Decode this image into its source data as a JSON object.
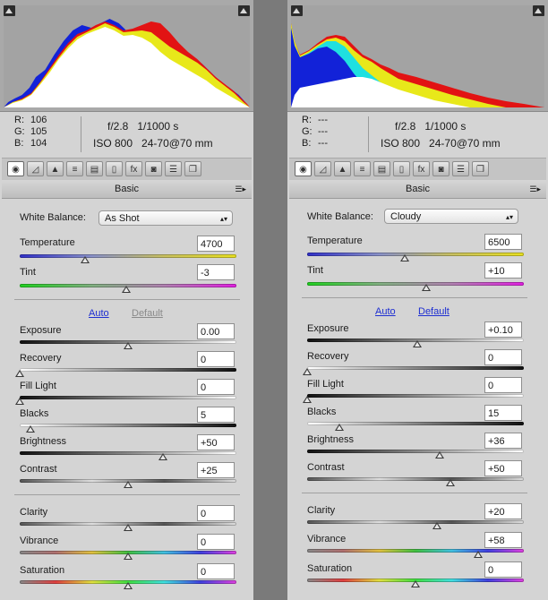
{
  "left": {
    "rgb": {
      "r_label": "R:",
      "r": "106",
      "g_label": "G:",
      "g": "105",
      "b_label": "B:",
      "b": "104"
    },
    "camera": {
      "aperture": "f/2.8",
      "shutter": "1/1000 s",
      "iso": "ISO 800",
      "lens": "24-70@70 mm"
    },
    "tab_title": "Basic",
    "white_balance": {
      "label": "White Balance:",
      "value": "As Shot"
    },
    "temperature": {
      "label": "Temperature",
      "value": "4700",
      "pos": 0.3
    },
    "tint": {
      "label": "Tint",
      "value": "-3",
      "pos": 0.49
    },
    "auto": "Auto",
    "default": "Default",
    "exposure": {
      "label": "Exposure",
      "value": "0.00",
      "pos": 0.5
    },
    "recovery": {
      "label": "Recovery",
      "value": "0",
      "pos": 0.0
    },
    "fill_light": {
      "label": "Fill Light",
      "value": "0",
      "pos": 0.0
    },
    "blacks": {
      "label": "Blacks",
      "value": "5",
      "pos": 0.05
    },
    "brightness": {
      "label": "Brightness",
      "value": "+50",
      "pos": 0.66
    },
    "contrast": {
      "label": "Contrast",
      "value": "+25",
      "pos": 0.5
    },
    "clarity": {
      "label": "Clarity",
      "value": "0",
      "pos": 0.5
    },
    "vibrance": {
      "label": "Vibrance",
      "value": "0",
      "pos": 0.5
    },
    "saturation": {
      "label": "Saturation",
      "value": "0",
      "pos": 0.5
    }
  },
  "right": {
    "rgb": {
      "r_label": "R:",
      "r": "---",
      "g_label": "G:",
      "g": "---",
      "b_label": "B:",
      "b": "---"
    },
    "camera": {
      "aperture": "f/2.8",
      "shutter": "1/1000 s",
      "iso": "ISO 800",
      "lens": "24-70@70 mm"
    },
    "tab_title": "Basic",
    "white_balance": {
      "label": "White Balance:",
      "value": "Cloudy"
    },
    "temperature": {
      "label": "Temperature",
      "value": "6500",
      "pos": 0.45
    },
    "tint": {
      "label": "Tint",
      "value": "+10",
      "pos": 0.55
    },
    "auto": "Auto",
    "default": "Default",
    "exposure": {
      "label": "Exposure",
      "value": "+0.10",
      "pos": 0.51
    },
    "recovery": {
      "label": "Recovery",
      "value": "0",
      "pos": 0.0
    },
    "fill_light": {
      "label": "Fill Light",
      "value": "0",
      "pos": 0.0
    },
    "blacks": {
      "label": "Blacks",
      "value": "15",
      "pos": 0.15
    },
    "brightness": {
      "label": "Brightness",
      "value": "+36",
      "pos": 0.61
    },
    "contrast": {
      "label": "Contrast",
      "value": "+50",
      "pos": 0.66
    },
    "clarity": {
      "label": "Clarity",
      "value": "+20",
      "pos": 0.6
    },
    "vibrance": {
      "label": "Vibrance",
      "value": "+58",
      "pos": 0.79
    },
    "saturation": {
      "label": "Saturation",
      "value": "0",
      "pos": 0.5
    }
  },
  "toolbar_icons": [
    "basic-icon",
    "tone-curve-icon",
    "detail-icon",
    "hsl-icon",
    "split-toning-icon",
    "lens-corrections-icon",
    "effects-icon",
    "camera-calibration-icon",
    "presets-icon",
    "snapshots-icon"
  ]
}
